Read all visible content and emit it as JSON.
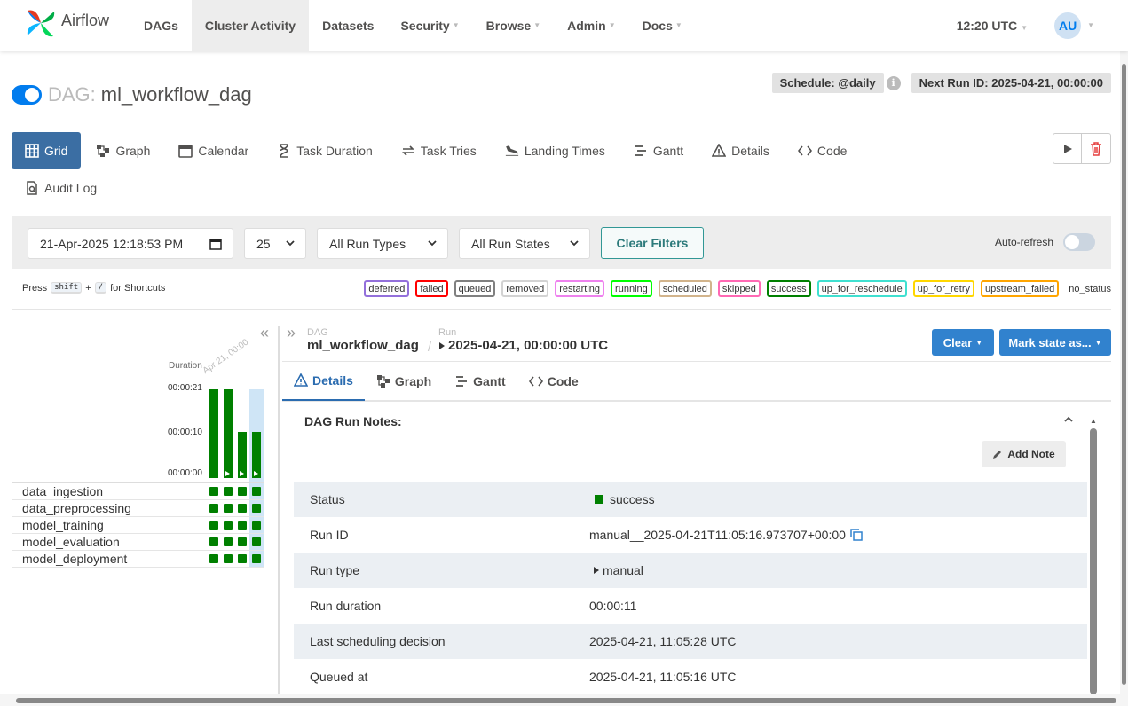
{
  "navbar": {
    "brand": "Airflow",
    "items": [
      {
        "label": "DAGs",
        "caret": false,
        "active": false
      },
      {
        "label": "Cluster Activity",
        "caret": false,
        "active": true
      },
      {
        "label": "Datasets",
        "caret": false,
        "active": false
      },
      {
        "label": "Security",
        "caret": true,
        "active": false
      },
      {
        "label": "Browse",
        "caret": true,
        "active": false
      },
      {
        "label": "Admin",
        "caret": true,
        "active": false
      },
      {
        "label": "Docs",
        "caret": true,
        "active": false
      }
    ],
    "time": "12:20 UTC",
    "avatar": "AU"
  },
  "dag": {
    "label": "DAG:",
    "name": "ml_workflow_dag",
    "schedule": "Schedule: @daily",
    "next_run": "Next Run ID: 2025-04-21, 00:00:00"
  },
  "view_tabs": [
    {
      "label": "Grid",
      "icon": "grid-icon",
      "active": true
    },
    {
      "label": "Graph",
      "icon": "graph-icon"
    },
    {
      "label": "Calendar",
      "icon": "calendar-icon"
    },
    {
      "label": "Task Duration",
      "icon": "hourglass-icon"
    },
    {
      "label": "Task Tries",
      "icon": "retry-icon"
    },
    {
      "label": "Landing Times",
      "icon": "plane-landing-icon"
    },
    {
      "label": "Gantt",
      "icon": "gantt-icon"
    },
    {
      "label": "Details",
      "icon": "warning-triangle-icon"
    },
    {
      "label": "Code",
      "icon": "code-icon"
    }
  ],
  "audit_log": "Audit Log",
  "filters": {
    "date": "21-Apr-2025 12:18:53 PM",
    "count": "25",
    "run_types": "All Run Types",
    "run_states": "All Run States",
    "clear": "Clear Filters",
    "autorefresh": "Auto-refresh"
  },
  "shortcuts": {
    "prefix": "Press",
    "key1": "shift",
    "plus": "+",
    "key2": "/",
    "suffix": "for Shortcuts"
  },
  "legend": [
    {
      "label": "deferred",
      "color": "#9370db"
    },
    {
      "label": "failed",
      "color": "#ff0000"
    },
    {
      "label": "queued",
      "color": "#808080"
    },
    {
      "label": "removed",
      "color": "#d3d3d3"
    },
    {
      "label": "restarting",
      "color": "#ee82ee"
    },
    {
      "label": "running",
      "color": "#00ff00"
    },
    {
      "label": "scheduled",
      "color": "#d2b48c"
    },
    {
      "label": "skipped",
      "color": "#ff69b4"
    },
    {
      "label": "success",
      "color": "#008000"
    },
    {
      "label": "up_for_reschedule",
      "color": "#40e0d0"
    },
    {
      "label": "up_for_retry",
      "color": "#ffd700"
    },
    {
      "label": "upstream_failed",
      "color": "#ffa500"
    }
  ],
  "no_status": "no_status",
  "grid": {
    "duration_label": "Duration",
    "run_label": "Apr 21, 00:00",
    "ticks": [
      "00:00:21",
      "00:00:10",
      "00:00:00"
    ],
    "run_durations_sec": [
      21,
      21,
      11,
      11
    ],
    "tasks": [
      "data_ingestion",
      "data_preprocessing",
      "model_training",
      "model_evaluation",
      "model_deployment"
    ]
  },
  "run_panel": {
    "dag_small": "DAG",
    "dag_name": "ml_workflow_dag",
    "run_small": "Run",
    "run_name": "2025-04-21, 00:00:00 UTC",
    "clear_btn": "Clear",
    "mark_btn": "Mark state as...",
    "subtabs": [
      {
        "label": "Details",
        "icon": "warning-triangle-icon",
        "active": true
      },
      {
        "label": "Graph",
        "icon": "graph-icon"
      },
      {
        "label": "Gantt",
        "icon": "gantt-icon"
      },
      {
        "label": "Code",
        "icon": "code-icon"
      }
    ],
    "notes_title": "DAG Run Notes:",
    "add_note": "Add Note",
    "rows": [
      {
        "key": "Status",
        "value": "success"
      },
      {
        "key": "Run ID",
        "value": "manual__2025-04-21T11:05:16.973707+00:00"
      },
      {
        "key": "Run type",
        "value": "manual"
      },
      {
        "key": "Run duration",
        "value": "00:00:11"
      },
      {
        "key": "Last scheduling decision",
        "value": "2025-04-21, 11:05:28 UTC"
      },
      {
        "key": "Queued at",
        "value": "2025-04-21, 11:05:16 UTC"
      }
    ]
  }
}
